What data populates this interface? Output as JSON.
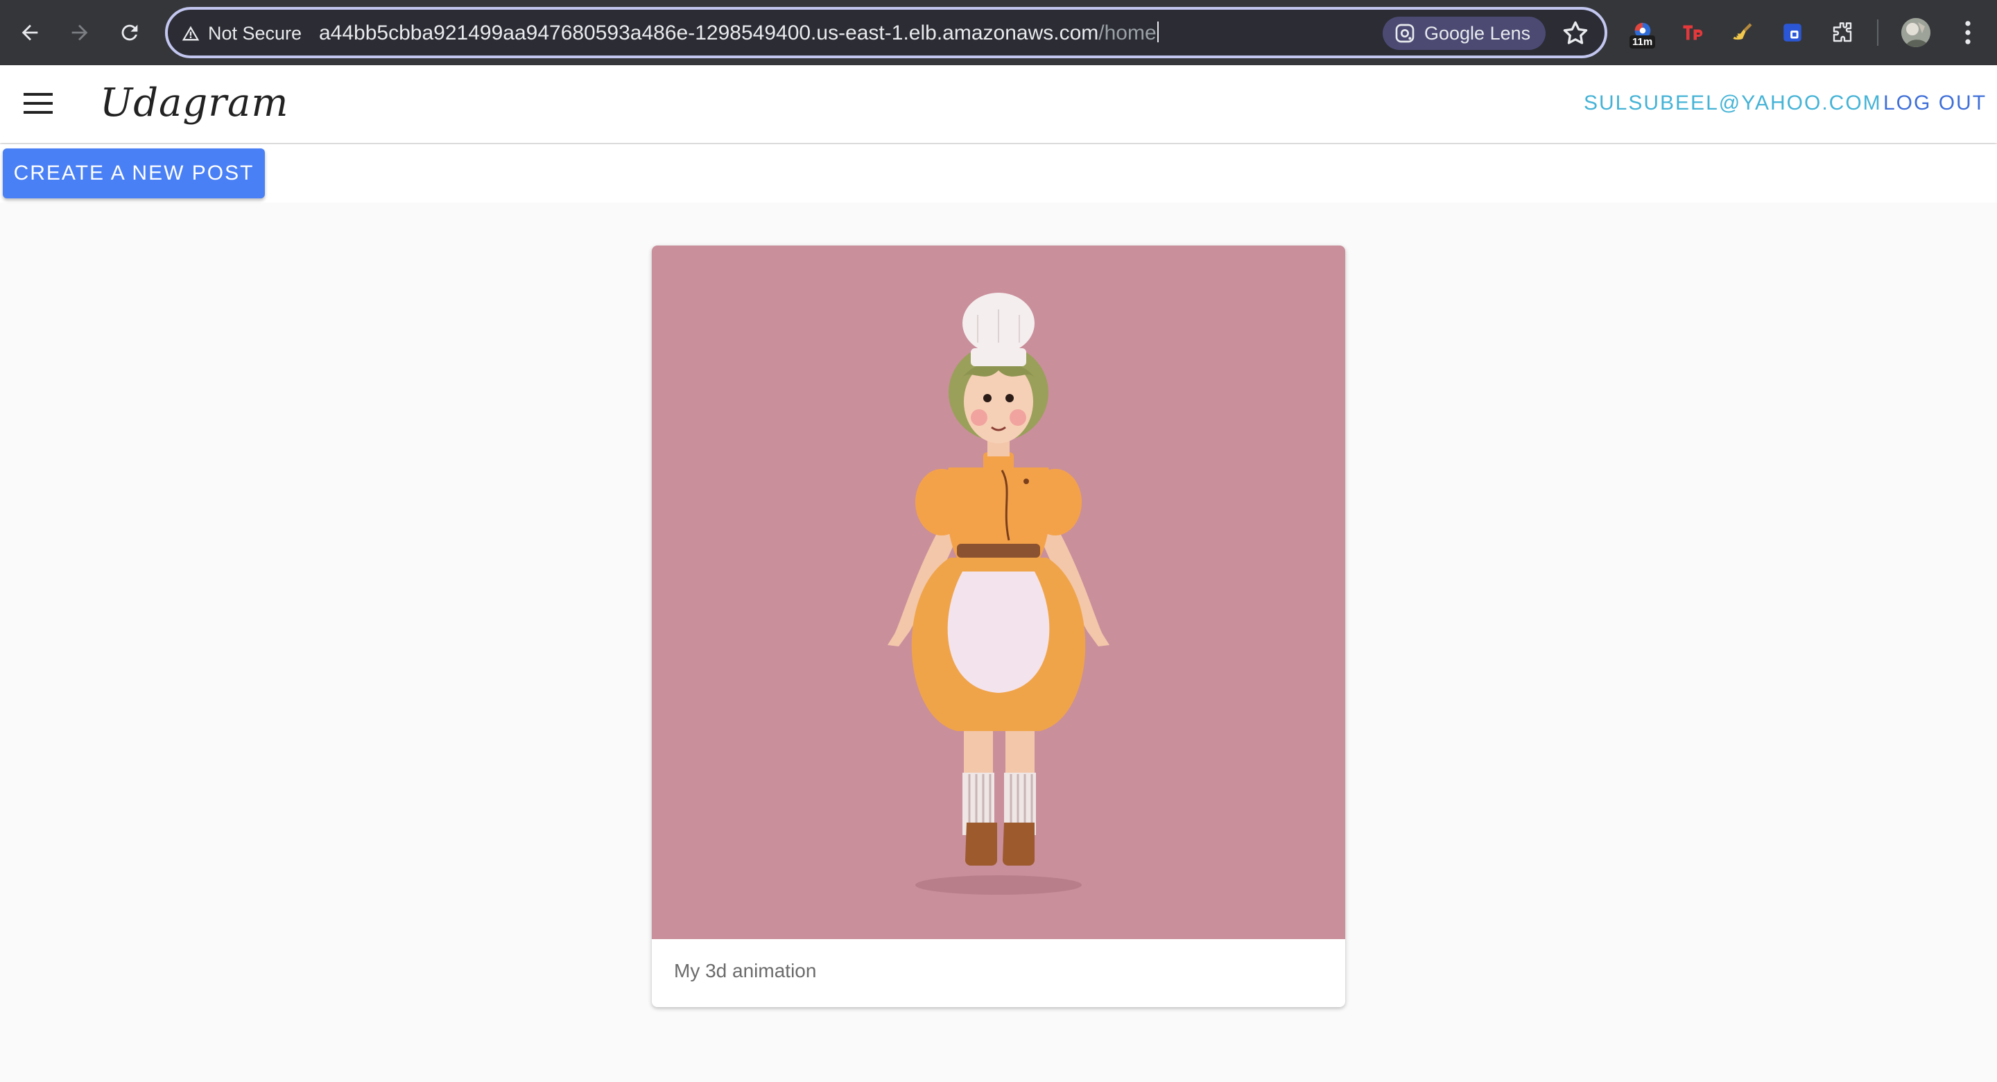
{
  "browser": {
    "security_label": "Not Secure",
    "url_host": "a44bb5cbba921499aa947680593a486e-1298549400.us-east-1.elb.amazonaws.com",
    "url_path": "/home",
    "lens_label": "Google Lens",
    "extension_badge": "11m",
    "icons": [
      "back-icon",
      "forward-icon",
      "reload-icon",
      "warning-icon",
      "google-lens-icon",
      "star-icon",
      "extensions-icon",
      "kebab-menu-icon"
    ]
  },
  "app": {
    "brand": "Udagram",
    "user_email": "SULSUBEEL@YAHOO.COM",
    "logout_label": "LOG OUT",
    "create_post_label": "CREATE A NEW POST",
    "accent_color": "#4a80f5"
  },
  "feed": {
    "items": [
      {
        "caption": "My 3d animation",
        "image_background": "#c98f9b"
      }
    ]
  }
}
